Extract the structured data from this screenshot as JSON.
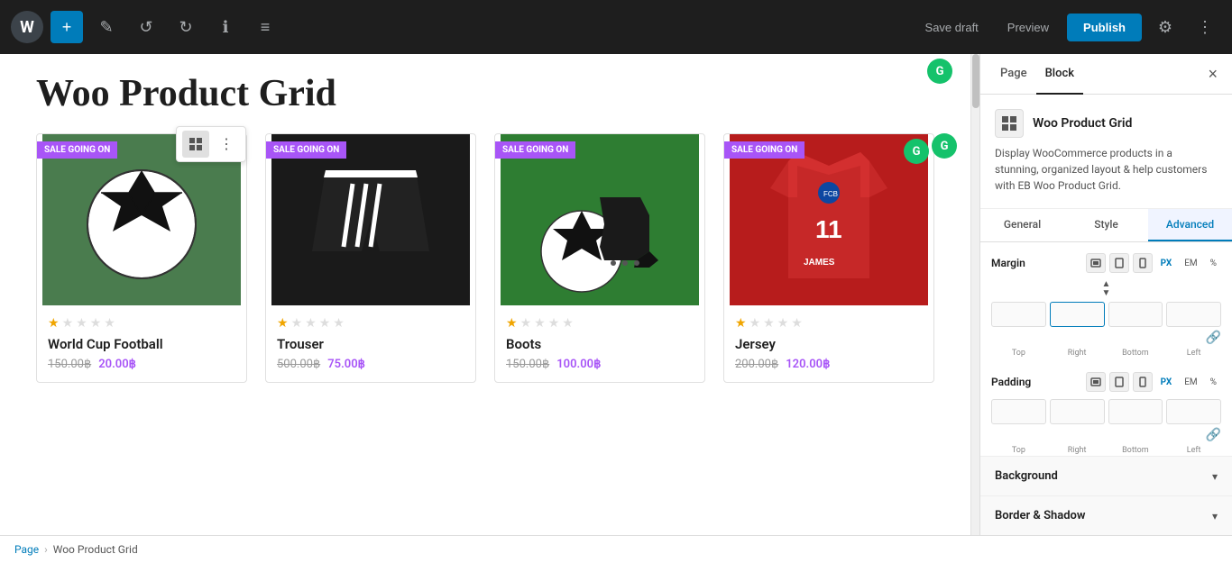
{
  "toolbar": {
    "wp_logo": "W",
    "add_label": "+",
    "edit_label": "✎",
    "undo_label": "↺",
    "redo_label": "↻",
    "info_label": "ℹ",
    "list_label": "≡",
    "save_draft_label": "Save draft",
    "preview_label": "Preview",
    "publish_label": "Publish",
    "settings_label": "⚙",
    "more_label": "⋮"
  },
  "canvas": {
    "page_title": "Woo Product Grid",
    "grammarly1": "G",
    "grammarly2": "G"
  },
  "block_toolbar": {
    "grid_icon": "⊞",
    "more_icon": "⋮"
  },
  "products": [
    {
      "id": 1,
      "sale_badge": "SALE GOING ON",
      "name": "World Cup Football",
      "price_original": "150.00",
      "price_sale": "20.00",
      "stars": [
        true,
        false,
        false,
        false,
        false
      ],
      "img_type": "ball"
    },
    {
      "id": 2,
      "sale_badge": "SALE GOING ON",
      "name": "Trouser",
      "price_original": "500.00",
      "price_sale": "75.00",
      "stars": [
        true,
        false,
        false,
        false,
        false
      ],
      "img_type": "shorts"
    },
    {
      "id": 3,
      "sale_badge": "SALE GOING ON",
      "name": "Boots",
      "price_original": "150.00",
      "price_sale": "100.00",
      "stars": [
        true,
        false,
        false,
        false,
        false
      ],
      "img_type": "boots"
    },
    {
      "id": 4,
      "sale_badge": "SALE GOING ON",
      "name": "Jersey",
      "price_original": "200.00",
      "price_sale": "120.00",
      "stars": [
        true,
        false,
        false,
        false,
        false
      ],
      "img_type": "jersey"
    }
  ],
  "panel": {
    "tab_page": "Page",
    "tab_block": "Block",
    "close_btn": "×",
    "block_icon": "⊞",
    "block_name": "Woo Product Grid",
    "block_description": "Display WooCommerce products in a stunning, organized layout & help customers with EB Woo Product Grid.",
    "sub_tab_general": "General",
    "sub_tab_style": "Style",
    "sub_tab_advanced": "Advanced",
    "margin_label": "Margin",
    "padding_label": "Padding",
    "unit_px": "PX",
    "unit_em": "EM",
    "unit_pct": "%",
    "margin_top": "",
    "margin_right": "",
    "margin_bottom": "",
    "margin_left": "",
    "margin_top_label": "Top",
    "margin_right_label": "Right",
    "margin_bottom_label": "Bottom",
    "margin_left_label": "Left",
    "padding_top": "",
    "padding_right": "",
    "padding_bottom": "",
    "padding_left": "",
    "padding_top_label": "Top",
    "padding_right_label": "Right",
    "padding_bottom_label": "Bottom",
    "padding_left_label": "Left",
    "background_label": "Background",
    "border_shadow_label": "Border & Shadow",
    "chevron_down": "▾",
    "right_active_label": "Right"
  },
  "breadcrumb": {
    "page_label": "Page",
    "separator": "›",
    "current": "Woo Product Grid"
  }
}
